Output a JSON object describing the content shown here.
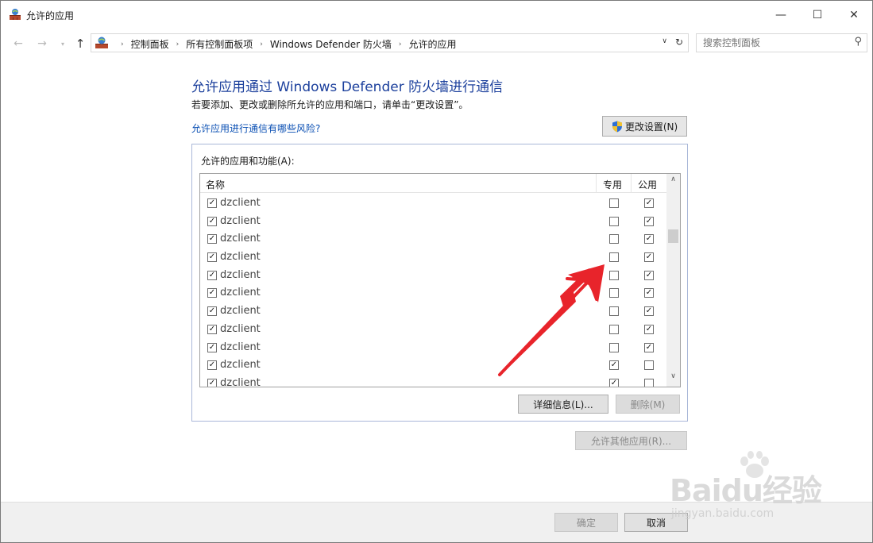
{
  "window": {
    "title": "允许的应用",
    "min_glyph": "—",
    "max_glyph": "☐",
    "close_glyph": "✕"
  },
  "nav": {
    "back_glyph": "←",
    "forward_glyph": "→",
    "recent_glyph": "▾",
    "up_glyph": "↑",
    "breadcrumbs": [
      "控制面板",
      "所有控制面板项",
      "Windows Defender 防火墙",
      "允许的应用"
    ],
    "breadcrumb_sep": "›",
    "dropdown_glyph": "∨",
    "refresh_glyph": "↻",
    "search_placeholder": "搜索控制面板",
    "search_glyph": "⚲"
  },
  "content": {
    "heading": "允许应用通过 Windows Defender 防火墙进行通信",
    "subtitle": "若要添加、更改或删除所允许的应用和端口，请单击“更改设置”。",
    "risk_link": "允许应用进行通信有哪些风险?",
    "change_settings_button": "更改设置(N)"
  },
  "apps_group": {
    "label": "允许的应用和功能(A):",
    "columns": {
      "name": "名称",
      "private": "专用",
      "public": "公用"
    },
    "rows": [
      {
        "name": "dzclient",
        "enabled": true,
        "private": false,
        "public": true
      },
      {
        "name": "dzclient",
        "enabled": true,
        "private": false,
        "public": true
      },
      {
        "name": "dzclient",
        "enabled": true,
        "private": false,
        "public": true
      },
      {
        "name": "dzclient",
        "enabled": true,
        "private": false,
        "public": true
      },
      {
        "name": "dzclient",
        "enabled": true,
        "private": false,
        "public": true
      },
      {
        "name": "dzclient",
        "enabled": true,
        "private": false,
        "public": true
      },
      {
        "name": "dzclient",
        "enabled": true,
        "private": false,
        "public": true
      },
      {
        "name": "dzclient",
        "enabled": true,
        "private": false,
        "public": true
      },
      {
        "name": "dzclient",
        "enabled": true,
        "private": false,
        "public": true
      },
      {
        "name": "dzclient",
        "enabled": true,
        "private": true,
        "public": false
      },
      {
        "name": "dzclient",
        "enabled": true,
        "private": true,
        "public": false
      }
    ],
    "scroll_up_glyph": "∧",
    "scroll_down_glyph": "∨",
    "details_button": "详细信息(L)...",
    "remove_button": "删除(M)"
  },
  "allow_other_button": "允许其他应用(R)...",
  "footer": {
    "ok_button": "确定",
    "cancel_button": "取消"
  },
  "watermark": {
    "brand": "Baidu经验",
    "url": "jingyan.baidu.com"
  },
  "colors": {
    "heading": "#1b3f9c",
    "link": "#0a4fb3",
    "annotation_arrow": "#e8242b",
    "group_border": "#a9b7d8"
  },
  "check_glyph": "✓"
}
